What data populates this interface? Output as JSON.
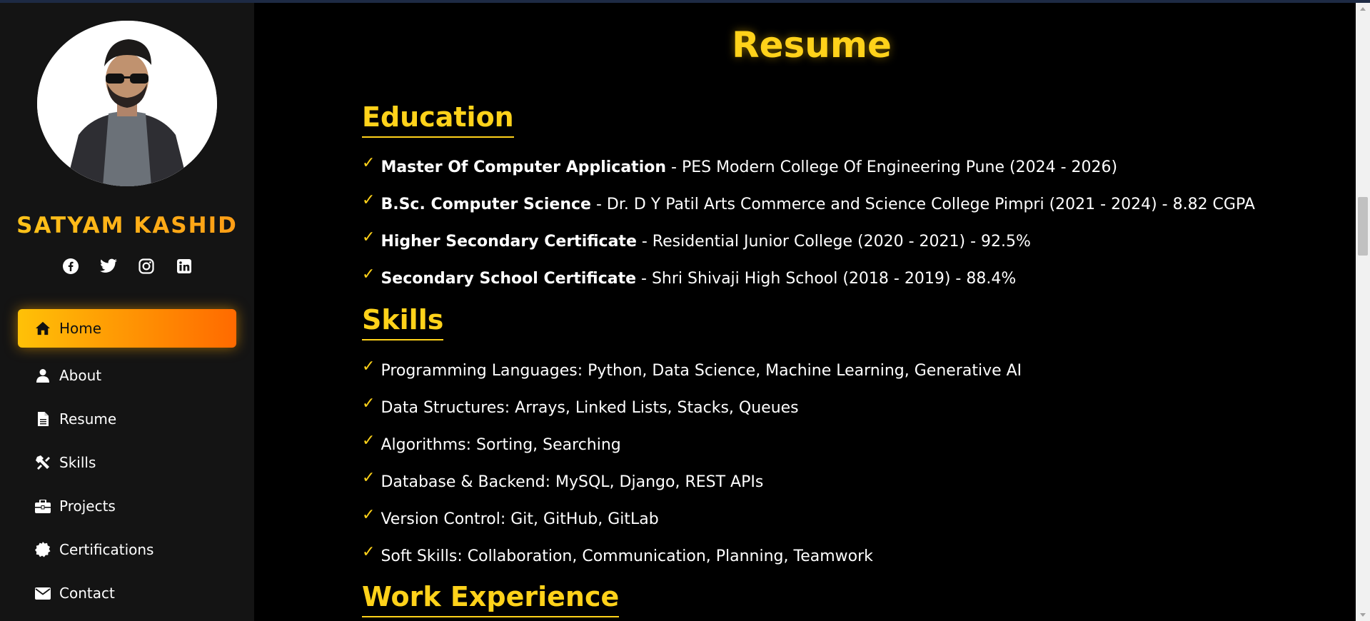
{
  "profile": {
    "name": "SATYAM KASHID"
  },
  "socials": [
    "facebook-icon",
    "twitter-icon",
    "instagram-icon",
    "linkedin-icon"
  ],
  "nav": [
    {
      "label": "Home",
      "icon": "home-icon",
      "active": true
    },
    {
      "label": "About",
      "icon": "user-icon"
    },
    {
      "label": "Resume",
      "icon": "file-icon"
    },
    {
      "label": "Skills",
      "icon": "tools-icon"
    },
    {
      "label": "Projects",
      "icon": "briefcase-icon"
    },
    {
      "label": "Certifications",
      "icon": "certificate-icon"
    },
    {
      "label": "Contact",
      "icon": "envelope-icon"
    }
  ],
  "page_title": "Resume",
  "education": {
    "heading": "Education",
    "items": [
      {
        "title": "Master Of Computer Application",
        "detail": " - PES Modern College Of Engineering Pune (2024 - 2026)"
      },
      {
        "title": "B.Sc. Computer Science",
        "detail": " - Dr. D Y Patil Arts Commerce and Science College Pimpri (2021 - 2024) - 8.82 CGPA"
      },
      {
        "title": "Higher Secondary Certificate",
        "detail": " - Residential Junior College (2020 - 2021) - 92.5%"
      },
      {
        "title": "Secondary School Certificate",
        "detail": " - Shri Shivaji High School (2018 - 2019) - 88.4%"
      }
    ]
  },
  "skills": {
    "heading": "Skills",
    "items": [
      "Programming Languages: Python, Data Science, Machine Learning, Generative AI",
      "Data Structures: Arrays, Linked Lists, Stacks, Queues",
      "Algorithms: Sorting, Searching",
      "Database & Backend: MySQL, Django, REST APIs",
      "Version Control: Git, GitHub, GitLab",
      "Soft Skills: Collaboration, Communication, Planning, Teamwork"
    ]
  },
  "work": {
    "heading": "Work Experience"
  },
  "check_glyph": "✓",
  "colors": {
    "accent": "#ffd21a",
    "nav_gradient_start": "#ffc107",
    "nav_gradient_end": "#ff6a00",
    "sidebar_bg": "#141414"
  }
}
